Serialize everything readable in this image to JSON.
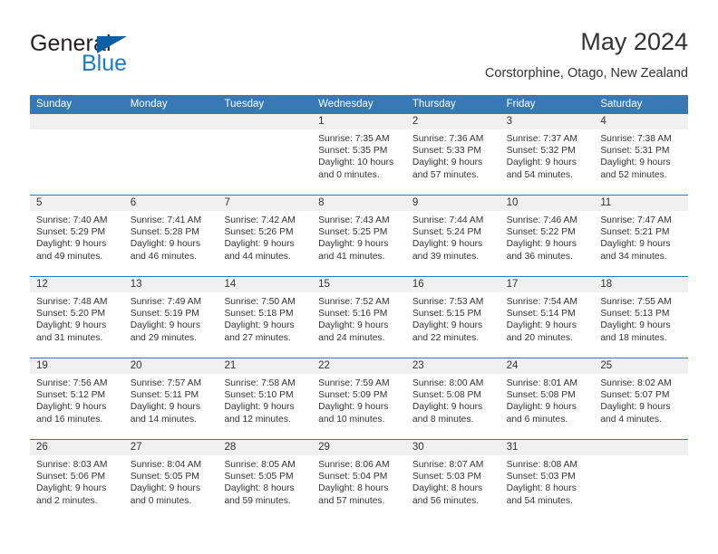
{
  "brand": {
    "line1": "General",
    "line2": "Blue",
    "triangle_color": "#0b5fa5",
    "blue_color": "#1f7bc1"
  },
  "header": {
    "title": "May 2024",
    "subtitle": "Corstorphine, Otago, New Zealand"
  },
  "theme": {
    "header_blue": "#3878b4",
    "date_band": "#f0f0f0",
    "text": "#333333"
  },
  "weekday_headers": [
    "Sunday",
    "Monday",
    "Tuesday",
    "Wednesday",
    "Thursday",
    "Friday",
    "Saturday"
  ],
  "weeks": [
    [
      {
        "day": "",
        "sunrise": "",
        "sunset": "",
        "daylight": ""
      },
      {
        "day": "",
        "sunrise": "",
        "sunset": "",
        "daylight": ""
      },
      {
        "day": "",
        "sunrise": "",
        "sunset": "",
        "daylight": ""
      },
      {
        "day": "1",
        "sunrise": "Sunrise: 7:35 AM",
        "sunset": "Sunset: 5:35 PM",
        "daylight": "Daylight: 10 hours and 0 minutes."
      },
      {
        "day": "2",
        "sunrise": "Sunrise: 7:36 AM",
        "sunset": "Sunset: 5:33 PM",
        "daylight": "Daylight: 9 hours and 57 minutes."
      },
      {
        "day": "3",
        "sunrise": "Sunrise: 7:37 AM",
        "sunset": "Sunset: 5:32 PM",
        "daylight": "Daylight: 9 hours and 54 minutes."
      },
      {
        "day": "4",
        "sunrise": "Sunrise: 7:38 AM",
        "sunset": "Sunset: 5:31 PM",
        "daylight": "Daylight: 9 hours and 52 minutes."
      }
    ],
    [
      {
        "day": "5",
        "sunrise": "Sunrise: 7:40 AM",
        "sunset": "Sunset: 5:29 PM",
        "daylight": "Daylight: 9 hours and 49 minutes."
      },
      {
        "day": "6",
        "sunrise": "Sunrise: 7:41 AM",
        "sunset": "Sunset: 5:28 PM",
        "daylight": "Daylight: 9 hours and 46 minutes."
      },
      {
        "day": "7",
        "sunrise": "Sunrise: 7:42 AM",
        "sunset": "Sunset: 5:26 PM",
        "daylight": "Daylight: 9 hours and 44 minutes."
      },
      {
        "day": "8",
        "sunrise": "Sunrise: 7:43 AM",
        "sunset": "Sunset: 5:25 PM",
        "daylight": "Daylight: 9 hours and 41 minutes."
      },
      {
        "day": "9",
        "sunrise": "Sunrise: 7:44 AM",
        "sunset": "Sunset: 5:24 PM",
        "daylight": "Daylight: 9 hours and 39 minutes."
      },
      {
        "day": "10",
        "sunrise": "Sunrise: 7:46 AM",
        "sunset": "Sunset: 5:22 PM",
        "daylight": "Daylight: 9 hours and 36 minutes."
      },
      {
        "day": "11",
        "sunrise": "Sunrise: 7:47 AM",
        "sunset": "Sunset: 5:21 PM",
        "daylight": "Daylight: 9 hours and 34 minutes."
      }
    ],
    [
      {
        "day": "12",
        "sunrise": "Sunrise: 7:48 AM",
        "sunset": "Sunset: 5:20 PM",
        "daylight": "Daylight: 9 hours and 31 minutes."
      },
      {
        "day": "13",
        "sunrise": "Sunrise: 7:49 AM",
        "sunset": "Sunset: 5:19 PM",
        "daylight": "Daylight: 9 hours and 29 minutes."
      },
      {
        "day": "14",
        "sunrise": "Sunrise: 7:50 AM",
        "sunset": "Sunset: 5:18 PM",
        "daylight": "Daylight: 9 hours and 27 minutes."
      },
      {
        "day": "15",
        "sunrise": "Sunrise: 7:52 AM",
        "sunset": "Sunset: 5:16 PM",
        "daylight": "Daylight: 9 hours and 24 minutes."
      },
      {
        "day": "16",
        "sunrise": "Sunrise: 7:53 AM",
        "sunset": "Sunset: 5:15 PM",
        "daylight": "Daylight: 9 hours and 22 minutes."
      },
      {
        "day": "17",
        "sunrise": "Sunrise: 7:54 AM",
        "sunset": "Sunset: 5:14 PM",
        "daylight": "Daylight: 9 hours and 20 minutes."
      },
      {
        "day": "18",
        "sunrise": "Sunrise: 7:55 AM",
        "sunset": "Sunset: 5:13 PM",
        "daylight": "Daylight: 9 hours and 18 minutes."
      }
    ],
    [
      {
        "day": "19",
        "sunrise": "Sunrise: 7:56 AM",
        "sunset": "Sunset: 5:12 PM",
        "daylight": "Daylight: 9 hours and 16 minutes."
      },
      {
        "day": "20",
        "sunrise": "Sunrise: 7:57 AM",
        "sunset": "Sunset: 5:11 PM",
        "daylight": "Daylight: 9 hours and 14 minutes."
      },
      {
        "day": "21",
        "sunrise": "Sunrise: 7:58 AM",
        "sunset": "Sunset: 5:10 PM",
        "daylight": "Daylight: 9 hours and 12 minutes."
      },
      {
        "day": "22",
        "sunrise": "Sunrise: 7:59 AM",
        "sunset": "Sunset: 5:09 PM",
        "daylight": "Daylight: 9 hours and 10 minutes."
      },
      {
        "day": "23",
        "sunrise": "Sunrise: 8:00 AM",
        "sunset": "Sunset: 5:08 PM",
        "daylight": "Daylight: 9 hours and 8 minutes."
      },
      {
        "day": "24",
        "sunrise": "Sunrise: 8:01 AM",
        "sunset": "Sunset: 5:08 PM",
        "daylight": "Daylight: 9 hours and 6 minutes."
      },
      {
        "day": "25",
        "sunrise": "Sunrise: 8:02 AM",
        "sunset": "Sunset: 5:07 PM",
        "daylight": "Daylight: 9 hours and 4 minutes."
      }
    ],
    [
      {
        "day": "26",
        "sunrise": "Sunrise: 8:03 AM",
        "sunset": "Sunset: 5:06 PM",
        "daylight": "Daylight: 9 hours and 2 minutes."
      },
      {
        "day": "27",
        "sunrise": "Sunrise: 8:04 AM",
        "sunset": "Sunset: 5:05 PM",
        "daylight": "Daylight: 9 hours and 0 minutes."
      },
      {
        "day": "28",
        "sunrise": "Sunrise: 8:05 AM",
        "sunset": "Sunset: 5:05 PM",
        "daylight": "Daylight: 8 hours and 59 minutes."
      },
      {
        "day": "29",
        "sunrise": "Sunrise: 8:06 AM",
        "sunset": "Sunset: 5:04 PM",
        "daylight": "Daylight: 8 hours and 57 minutes."
      },
      {
        "day": "30",
        "sunrise": "Sunrise: 8:07 AM",
        "sunset": "Sunset: 5:03 PM",
        "daylight": "Daylight: 8 hours and 56 minutes."
      },
      {
        "day": "31",
        "sunrise": "Sunrise: 8:08 AM",
        "sunset": "Sunset: 5:03 PM",
        "daylight": "Daylight: 8 hours and 54 minutes."
      },
      {
        "day": "",
        "sunrise": "",
        "sunset": "",
        "daylight": ""
      }
    ]
  ]
}
